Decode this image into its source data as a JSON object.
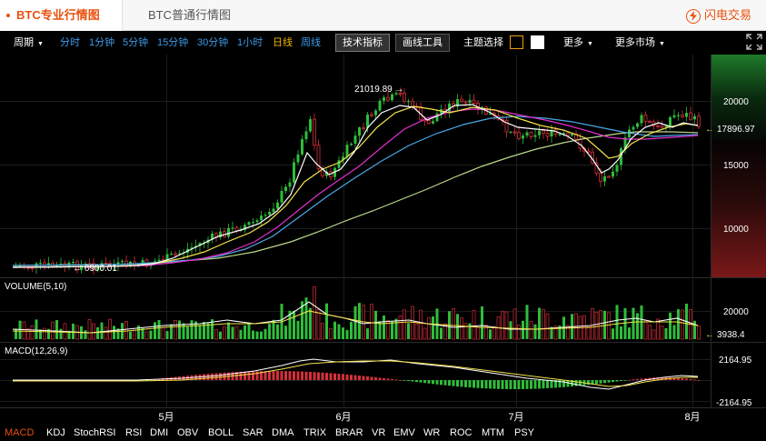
{
  "header": {
    "tabs": [
      {
        "label": "BTC专业行情图",
        "active": true
      },
      {
        "label": "BTC普通行情图",
        "active": false
      }
    ],
    "brand": "闪电交易"
  },
  "toolbar": {
    "period_label": "周期",
    "periods": [
      "分时",
      "1分钟",
      "5分钟",
      "15分钟",
      "30分钟",
      "1小时",
      "日线",
      "周线"
    ],
    "active_period": "日线",
    "tech_indicator": "技术指标",
    "drawing_tool": "画线工具",
    "theme_label": "主题选择",
    "more": "更多",
    "more_markets": "更多市场"
  },
  "price_panel": {
    "y_ticks": [
      "20000",
      "15000",
      "10000"
    ],
    "high_annotation": "21019.89",
    "low_annotation": "6900.01",
    "last_price": "17896.97"
  },
  "volume_panel": {
    "label": "VOLUME(5,10)",
    "y_tick": "20000",
    "last_value": "3938.4"
  },
  "macd_panel": {
    "label": "MACD(12,26,9)",
    "y_top": "2164.95",
    "y_bottom": "-2164.95"
  },
  "x_axis": {
    "labels": [
      "5月",
      "6月",
      "7月",
      "8月"
    ]
  },
  "indicators": [
    "MACD",
    "KDJ",
    "StochRSI",
    "RSI",
    "DMI",
    "OBV",
    "BOLL",
    "SAR",
    "DMA",
    "TRIX",
    "BRAR",
    "VR",
    "EMV",
    "WR",
    "ROC",
    "MTM",
    "PSY"
  ],
  "active_indicator": "MACD",
  "colors": {
    "up": "#2ebd3a",
    "down": "#d6303a",
    "accent": "#e8510e",
    "active_period": "#f0b400",
    "period": "#3d9be9",
    "ma5": "#ffffff",
    "ma10": "#f3e24a",
    "ma20": "#e22fd0",
    "ma30": "#4aa8e6",
    "ma60": "#b9d88a"
  },
  "chart_data": {
    "type": "candlestick",
    "x": [
      "5月",
      "6月",
      "7月",
      "8月"
    ],
    "y_range": [
      6900.01,
      21019.89
    ],
    "high": 21019.89,
    "low": 6900.01,
    "last": 17896.97,
    "volume_last": 3938.4,
    "macd_range": [
      -2164.95,
      2164.95
    ]
  }
}
